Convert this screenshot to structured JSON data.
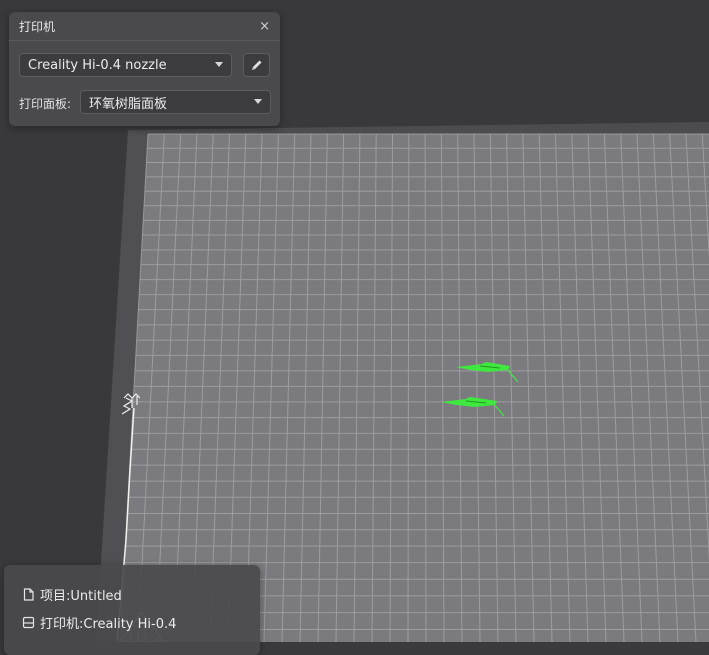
{
  "printer_panel": {
    "title": "打印机",
    "close_label": "×",
    "nozzle_selected": "Creality Hi-0.4 nozzle",
    "bed_label": "打印面板:",
    "bed_selected": "环氧树脂面板"
  },
  "status": {
    "project": "项目:Untitled",
    "printer": "打印机:Creality Hi-0.4"
  },
  "icons": {
    "edit": "pencil-icon",
    "dropdown": "chevron-down-icon",
    "project": "file-icon",
    "printer": "printer-icon"
  },
  "colors": {
    "background": "#3a3a3c",
    "plate": "#7b7b7f",
    "grid": "#a9a9ad",
    "model": "#3fe83f",
    "panel": "#4a4a4d"
  }
}
